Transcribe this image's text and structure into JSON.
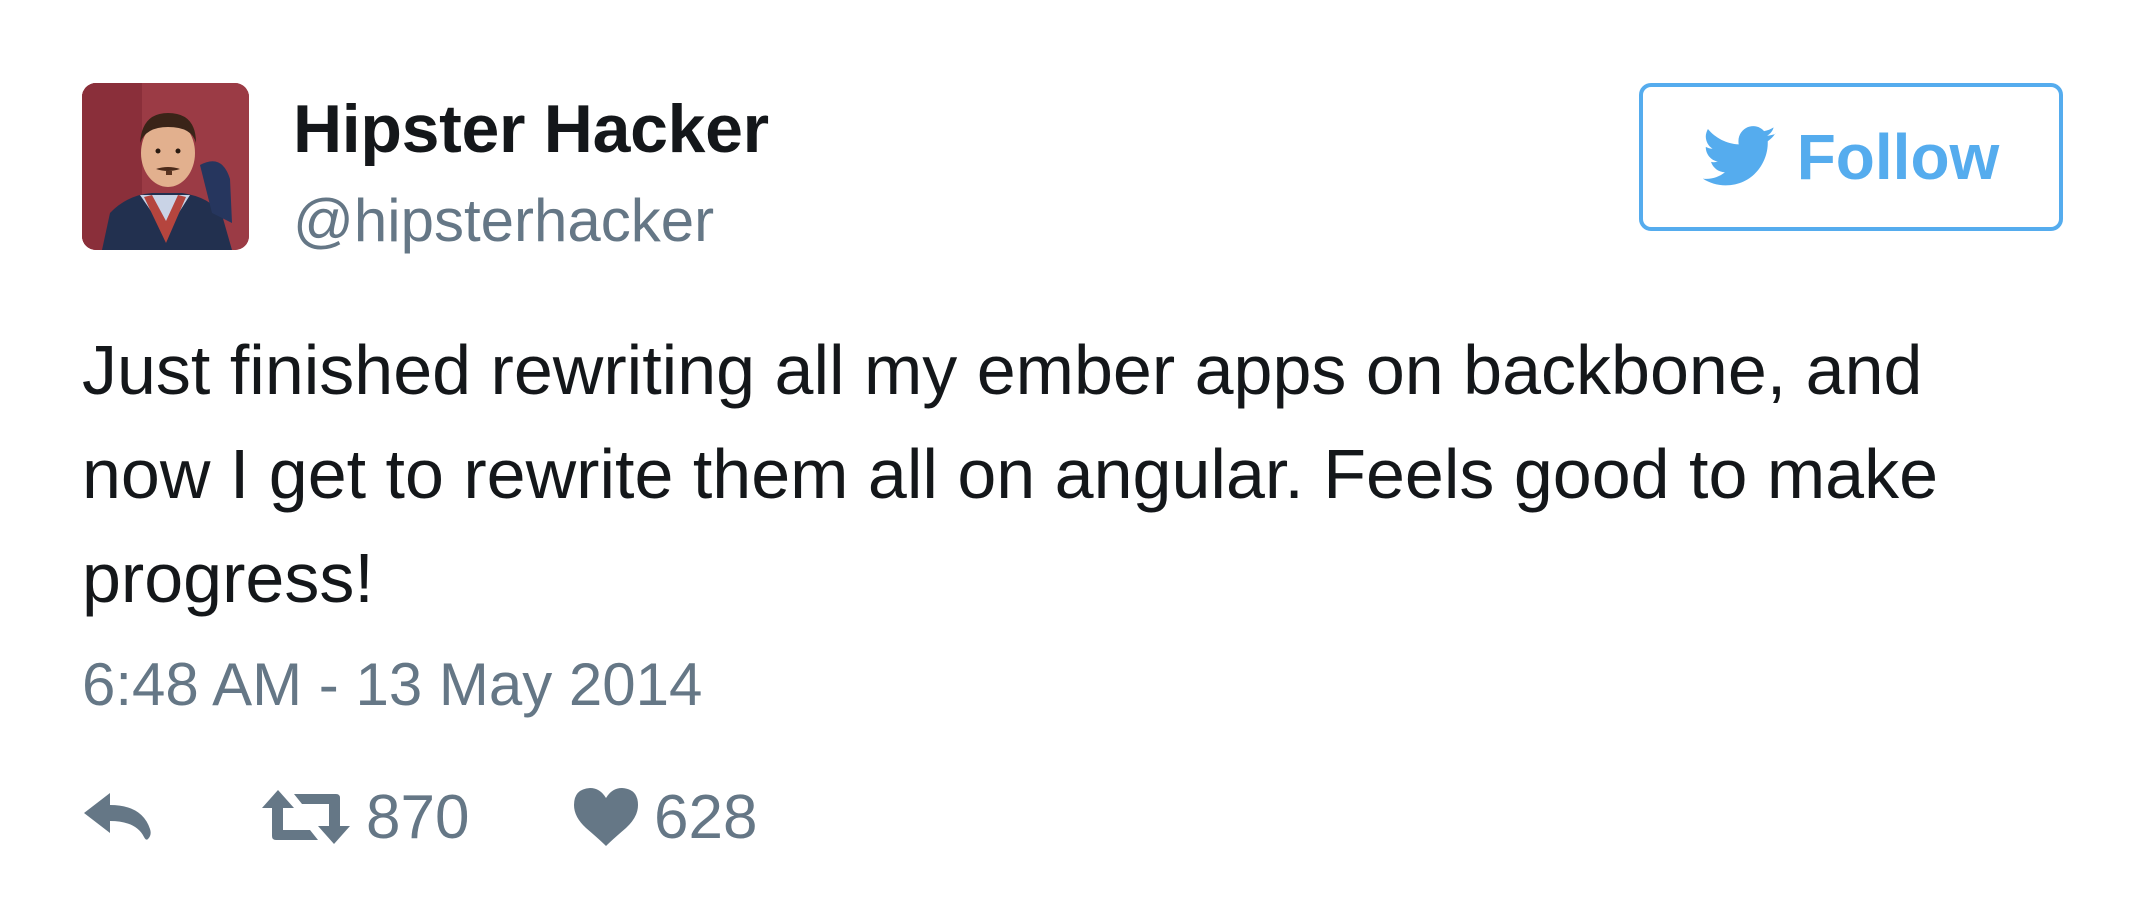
{
  "user": {
    "display_name": "Hipster Hacker",
    "handle": "@hipsterhacker"
  },
  "follow_button": {
    "label": "Follow",
    "icon": "twitter-bird-icon"
  },
  "tweet": {
    "text": "Just finished rewriting all my ember apps on backbone, and\nnow I get to rewrite them all on angular. Feels good to make\nprogress!",
    "timestamp": "6:48 AM - 13 May 2014"
  },
  "actions": {
    "reply": {
      "icon": "reply-icon"
    },
    "retweet": {
      "icon": "retweet-icon",
      "count": "870"
    },
    "like": {
      "icon": "heart-icon",
      "count": "628"
    }
  },
  "colors": {
    "accent": "#55acee",
    "text": "#14171a",
    "secondary": "#657786"
  }
}
